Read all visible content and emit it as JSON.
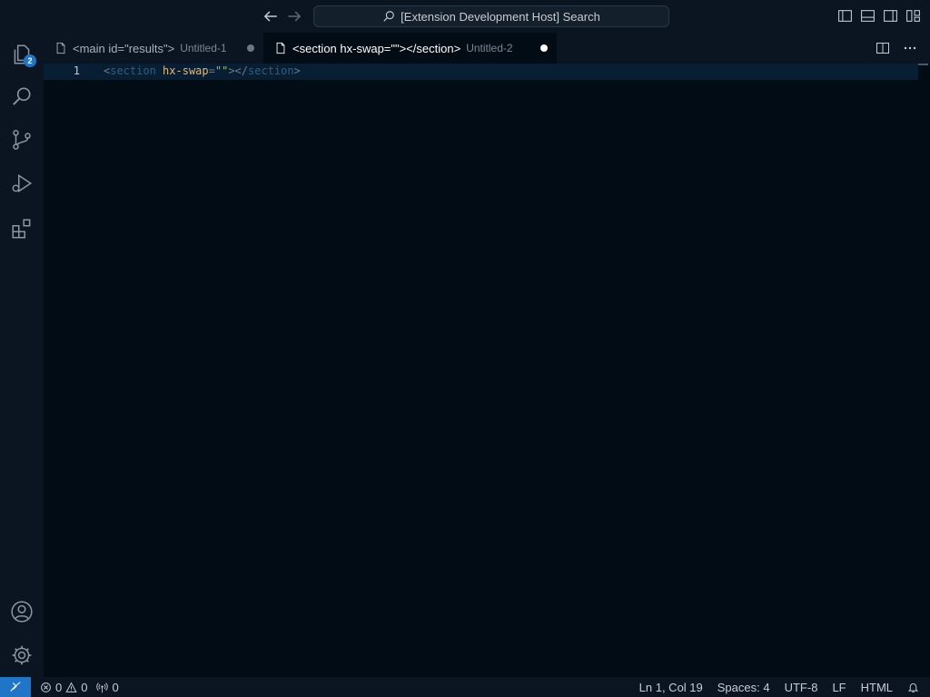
{
  "titlebar": {
    "search_text": "[Extension Development Host] Search"
  },
  "activity": {
    "explorer_badge": "2"
  },
  "tabs": [
    {
      "label": "<main id=\"results\">",
      "description": "Untitled-1"
    },
    {
      "label": "<section hx-swap=\"\"></section>",
      "description": "Untitled-2"
    }
  ],
  "editor": {
    "line_number": "1",
    "tokens": {
      "open_bracket": "<",
      "tag_open": "section",
      "space": " ",
      "attr": "hx-swap",
      "equals": "=",
      "string": "\"\"",
      "close_open": "></",
      "tag_close": "section",
      "close_bracket": ">"
    }
  },
  "statusbar": {
    "errors": "0",
    "warnings": "0",
    "ports": "0",
    "position": "Ln 1, Col 19",
    "spaces": "Spaces: 4",
    "encoding": "UTF-8",
    "eol": "LF",
    "language": "HTML"
  },
  "colors": {
    "accent": "#1f76c9",
    "editor_bg": "#010c15",
    "chrome_bg": "#0b1521"
  }
}
